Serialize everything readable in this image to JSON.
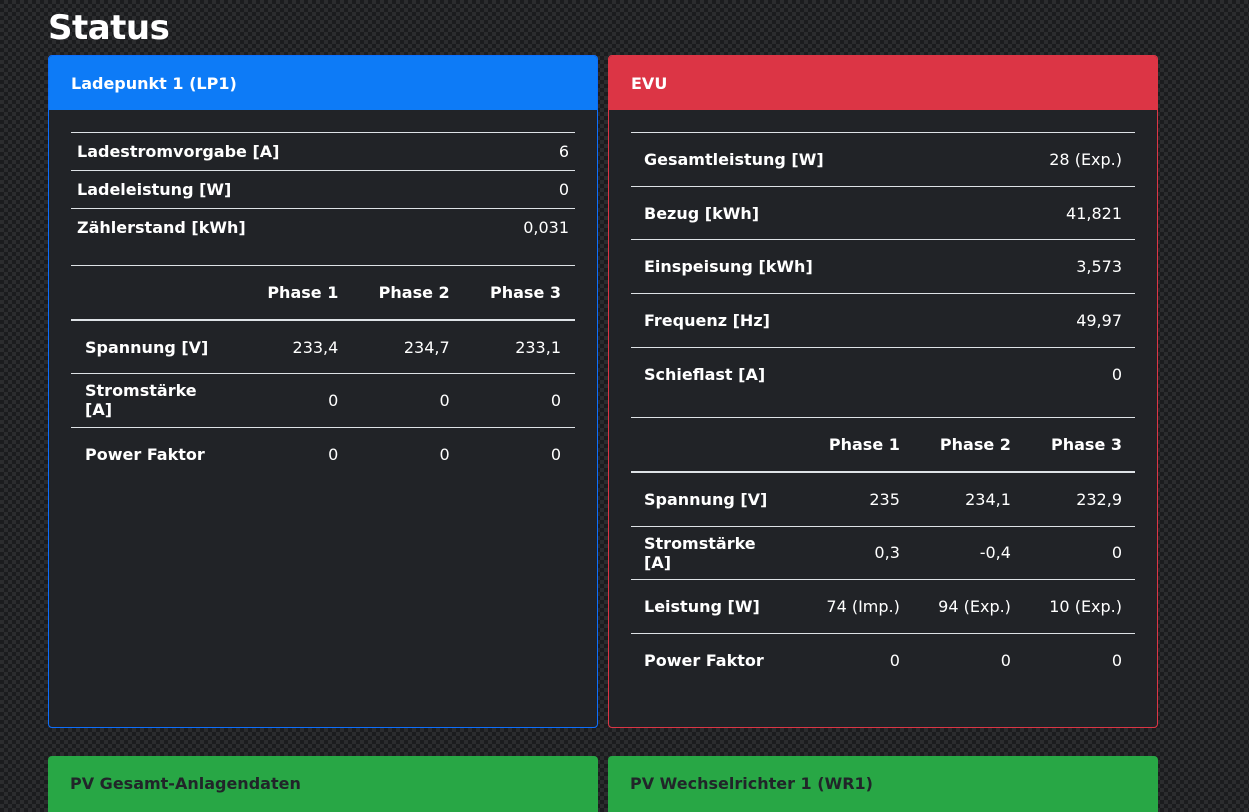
{
  "page": {
    "title": "Status"
  },
  "lp1": {
    "header": "Ladepunkt 1 (LP1)",
    "summary": [
      {
        "label": "Ladestromvorgabe [A]",
        "value": "6"
      },
      {
        "label": "Ladeleistung [W]",
        "value": "0"
      },
      {
        "label": "Zählerstand [kWh]",
        "value": "0,031"
      }
    ],
    "phase_headers": [
      "Phase 1",
      "Phase 2",
      "Phase 3"
    ],
    "phase_rows": [
      {
        "label": "Spannung [V]",
        "values": [
          "233,4",
          "234,7",
          "233,1"
        ]
      },
      {
        "label": "Stromstärke [A]",
        "values": [
          "0",
          "0",
          "0"
        ]
      },
      {
        "label": "Power Faktor",
        "values": [
          "0",
          "0",
          "0"
        ]
      }
    ]
  },
  "evu": {
    "header": "EVU",
    "summary": [
      {
        "label": "Gesamtleistung [W]",
        "value": "28 (Exp.)"
      },
      {
        "label": "Bezug [kWh]",
        "value": "41,821"
      },
      {
        "label": "Einspeisung [kWh]",
        "value": "3,573"
      },
      {
        "label": "Frequenz [Hz]",
        "value": "49,97"
      },
      {
        "label": "Schieflast [A]",
        "value": "0"
      }
    ],
    "phase_headers": [
      "Phase 1",
      "Phase 2",
      "Phase 3"
    ],
    "phase_rows": [
      {
        "label": "Spannung [V]",
        "values": [
          "235",
          "234,1",
          "232,9"
        ]
      },
      {
        "label": "Stromstärke [A]",
        "values": [
          "0,3",
          "-0,4",
          "0"
        ]
      },
      {
        "label": "Leistung [W]",
        "values": [
          "74 (Imp.)",
          "94 (Exp.)",
          "10 (Exp.)"
        ]
      },
      {
        "label": "Power Faktor",
        "values": [
          "0",
          "0",
          "0"
        ]
      }
    ]
  },
  "pv_total": {
    "header": "PV Gesamt-Anlagendaten"
  },
  "pv_wr1": {
    "header": "PV Wechselrichter 1 (WR1)"
  },
  "colors": {
    "lp1_accent": "#0d7bf7",
    "evu_accent": "#dc3545",
    "pv_accent": "#28a745",
    "card_bg": "#212327"
  }
}
